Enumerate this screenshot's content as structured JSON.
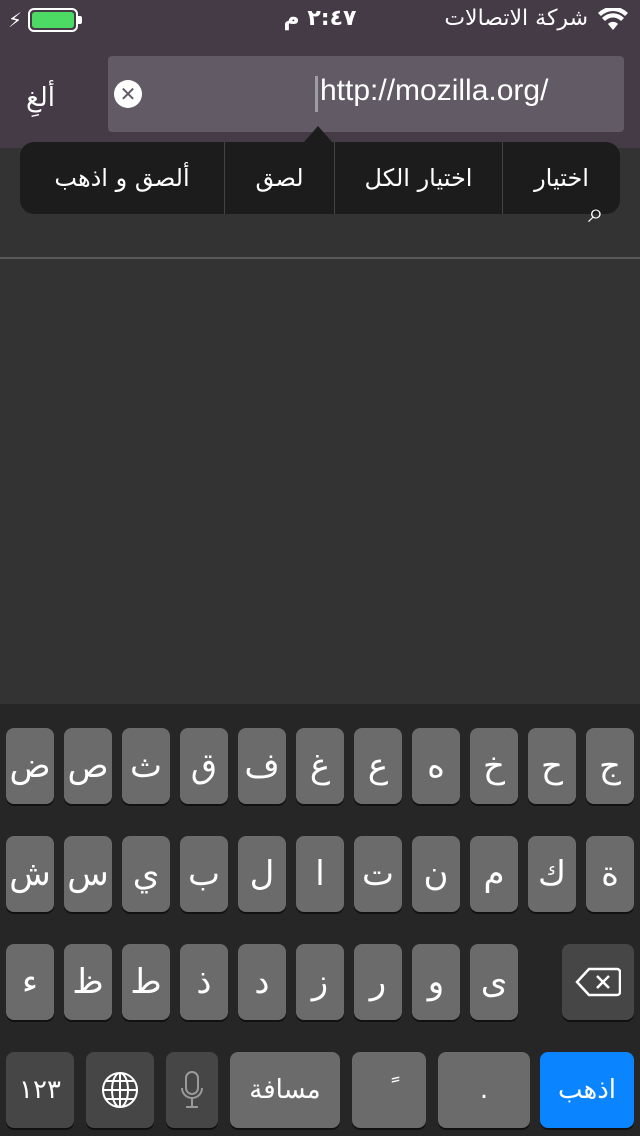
{
  "status_bar": {
    "carrier": "شركة الاتصالات",
    "time": "٢:٤٧ م",
    "battery_level": 1.0,
    "battery_color": "#4cd964"
  },
  "header": {
    "cancel_label": "ألغِ",
    "url_value": "http://mozilla.org/"
  },
  "context_menu": {
    "items": [
      "اختيار",
      "اختيار الكل",
      "لصق",
      "ألصق و اذهب"
    ]
  },
  "keyboard": {
    "row1": [
      "ج",
      "ح",
      "خ",
      "ه",
      "ع",
      "غ",
      "ف",
      "ق",
      "ث",
      "ص",
      "ض"
    ],
    "row2": [
      "ة",
      "ك",
      "م",
      "ن",
      "ت",
      "ا",
      "ل",
      "ب",
      "ي",
      "س",
      "ش"
    ],
    "row3": [
      "ى",
      "و",
      "ر",
      "ز",
      "د",
      "ذ",
      "ط",
      "ظ",
      "ء"
    ],
    "numbers_label": "١٢٣",
    "space_label": "مسافة",
    "diacritic_label": "ً",
    "period_label": ".",
    "go_label": "اذهب",
    "go_color": "#0a84ff"
  }
}
